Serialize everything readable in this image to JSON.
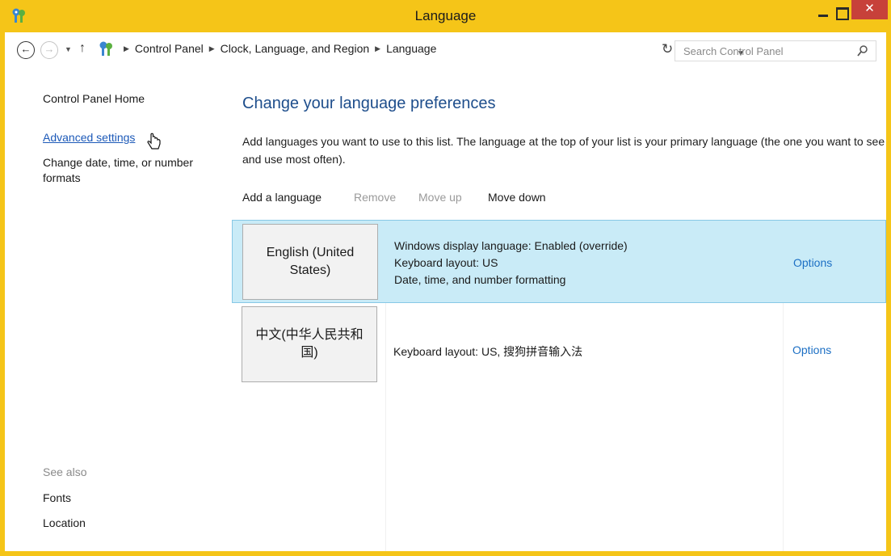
{
  "window": {
    "title": "Language"
  },
  "titlebar": {
    "close_glyph": "✕"
  },
  "nav": {
    "breadcrumbs": [
      "Control Panel",
      "Clock, Language, and Region",
      "Language"
    ],
    "search_placeholder": "Search Control Panel"
  },
  "sidebar": {
    "home": "Control Panel Home",
    "advanced": "Advanced settings",
    "date_formats": "Change date, time, or number formats",
    "see_also": "See also",
    "fonts": "Fonts",
    "location": "Location"
  },
  "main": {
    "heading": "Change your language preferences",
    "description": "Add languages you want to use to this list. The language at the top of your list is your primary language (the one you want to see and use most often).",
    "toolbar": {
      "add": "Add a language",
      "remove": "Remove",
      "move_up": "Move up",
      "move_down": "Move down"
    },
    "languages": [
      {
        "name": "English (United States)",
        "details": [
          "Windows display language: Enabled (override)",
          "Keyboard layout: US",
          "Date, time, and number formatting"
        ],
        "options": "Options"
      },
      {
        "name": "中文(中华人民共和国)",
        "details": [
          "Keyboard layout: US, 搜狗拼音输入法"
        ],
        "options": "Options"
      }
    ]
  },
  "icons": {
    "app": "control-panel-icon",
    "back": "back-arrow-icon",
    "forward": "forward-arrow-icon",
    "up": "up-arrow-icon",
    "refresh": "refresh-icon",
    "search": "search-icon",
    "cursor": "hand-cursor-icon"
  },
  "colors": {
    "titlebar": "#f5c518",
    "close_button": "#c7413a",
    "link": "#1c59b8",
    "heading": "#1e4e8c",
    "selected_row": "#c9ebf7"
  }
}
